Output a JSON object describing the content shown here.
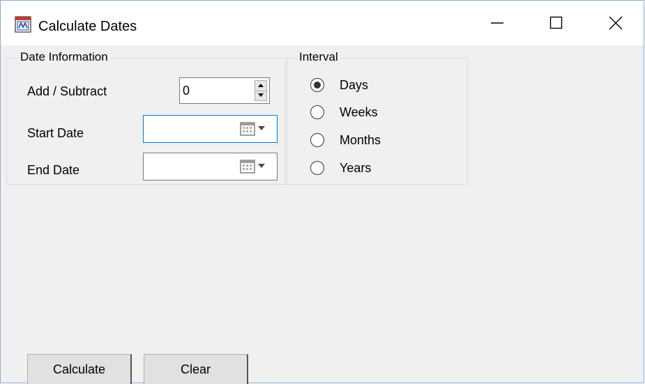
{
  "window": {
    "title": "Calculate Dates"
  },
  "date_info": {
    "legend": "Date Information",
    "add_subtract_label": "Add / Subtract",
    "add_subtract_value": "0",
    "start_date_label": "Start Date",
    "start_date_value": "",
    "end_date_label": "End Date",
    "end_date_value": ""
  },
  "interval": {
    "legend": "Interval",
    "options": [
      {
        "label": "Days",
        "selected": true
      },
      {
        "label": "Weeks",
        "selected": false
      },
      {
        "label": "Months",
        "selected": false
      },
      {
        "label": "Years",
        "selected": false
      }
    ]
  },
  "buttons": {
    "calculate": "Calculate",
    "clear": "Clear"
  },
  "colors": {
    "focus_border": "#0078d7",
    "window_bg": "#f0f0f0",
    "button_bg": "#e1e1e1"
  }
}
